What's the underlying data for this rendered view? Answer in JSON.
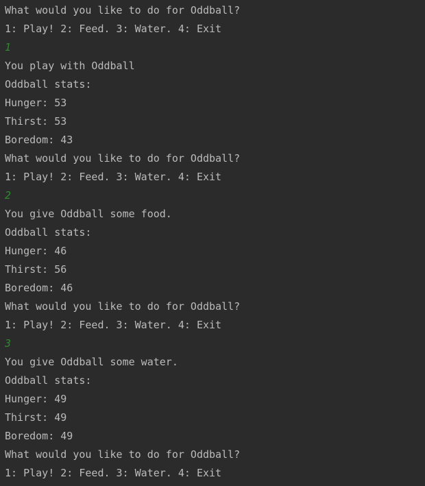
{
  "console": {
    "lines": [
      {
        "text": "What would you like to do for Oddball?",
        "kind": "output"
      },
      {
        "text": "1: Play! 2: Feed. 3: Water. 4: Exit",
        "kind": "output"
      },
      {
        "text": "1",
        "kind": "input"
      },
      {
        "text": "You play with Oddball",
        "kind": "output"
      },
      {
        "text": "Oddball stats:",
        "kind": "output"
      },
      {
        "text": "Hunger: 53",
        "kind": "output"
      },
      {
        "text": "Thirst: 53",
        "kind": "output"
      },
      {
        "text": "Boredom: 43",
        "kind": "output"
      },
      {
        "text": "What would you like to do for Oddball?",
        "kind": "output"
      },
      {
        "text": "1: Play! 2: Feed. 3: Water. 4: Exit",
        "kind": "output"
      },
      {
        "text": "2",
        "kind": "input"
      },
      {
        "text": "You give Oddball some food.",
        "kind": "output"
      },
      {
        "text": "Oddball stats:",
        "kind": "output"
      },
      {
        "text": "Hunger: 46",
        "kind": "output"
      },
      {
        "text": "Thirst: 56",
        "kind": "output"
      },
      {
        "text": "Boredom: 46",
        "kind": "output"
      },
      {
        "text": "What would you like to do for Oddball?",
        "kind": "output"
      },
      {
        "text": "1: Play! 2: Feed. 3: Water. 4: Exit",
        "kind": "output"
      },
      {
        "text": "3",
        "kind": "input"
      },
      {
        "text": "You give Oddball some water.",
        "kind": "output"
      },
      {
        "text": "Oddball stats:",
        "kind": "output"
      },
      {
        "text": "Hunger: 49",
        "kind": "output"
      },
      {
        "text": "Thirst: 49",
        "kind": "output"
      },
      {
        "text": "Boredom: 49",
        "kind": "output"
      },
      {
        "text": "What would you like to do for Oddball?",
        "kind": "output"
      },
      {
        "text": "1: Play! 2: Feed. 3: Water. 4: Exit",
        "kind": "output"
      }
    ]
  },
  "colors": {
    "background": "#2b2b2b",
    "output_text": "#bbbbbb",
    "input_text": "#2f8a2f"
  }
}
